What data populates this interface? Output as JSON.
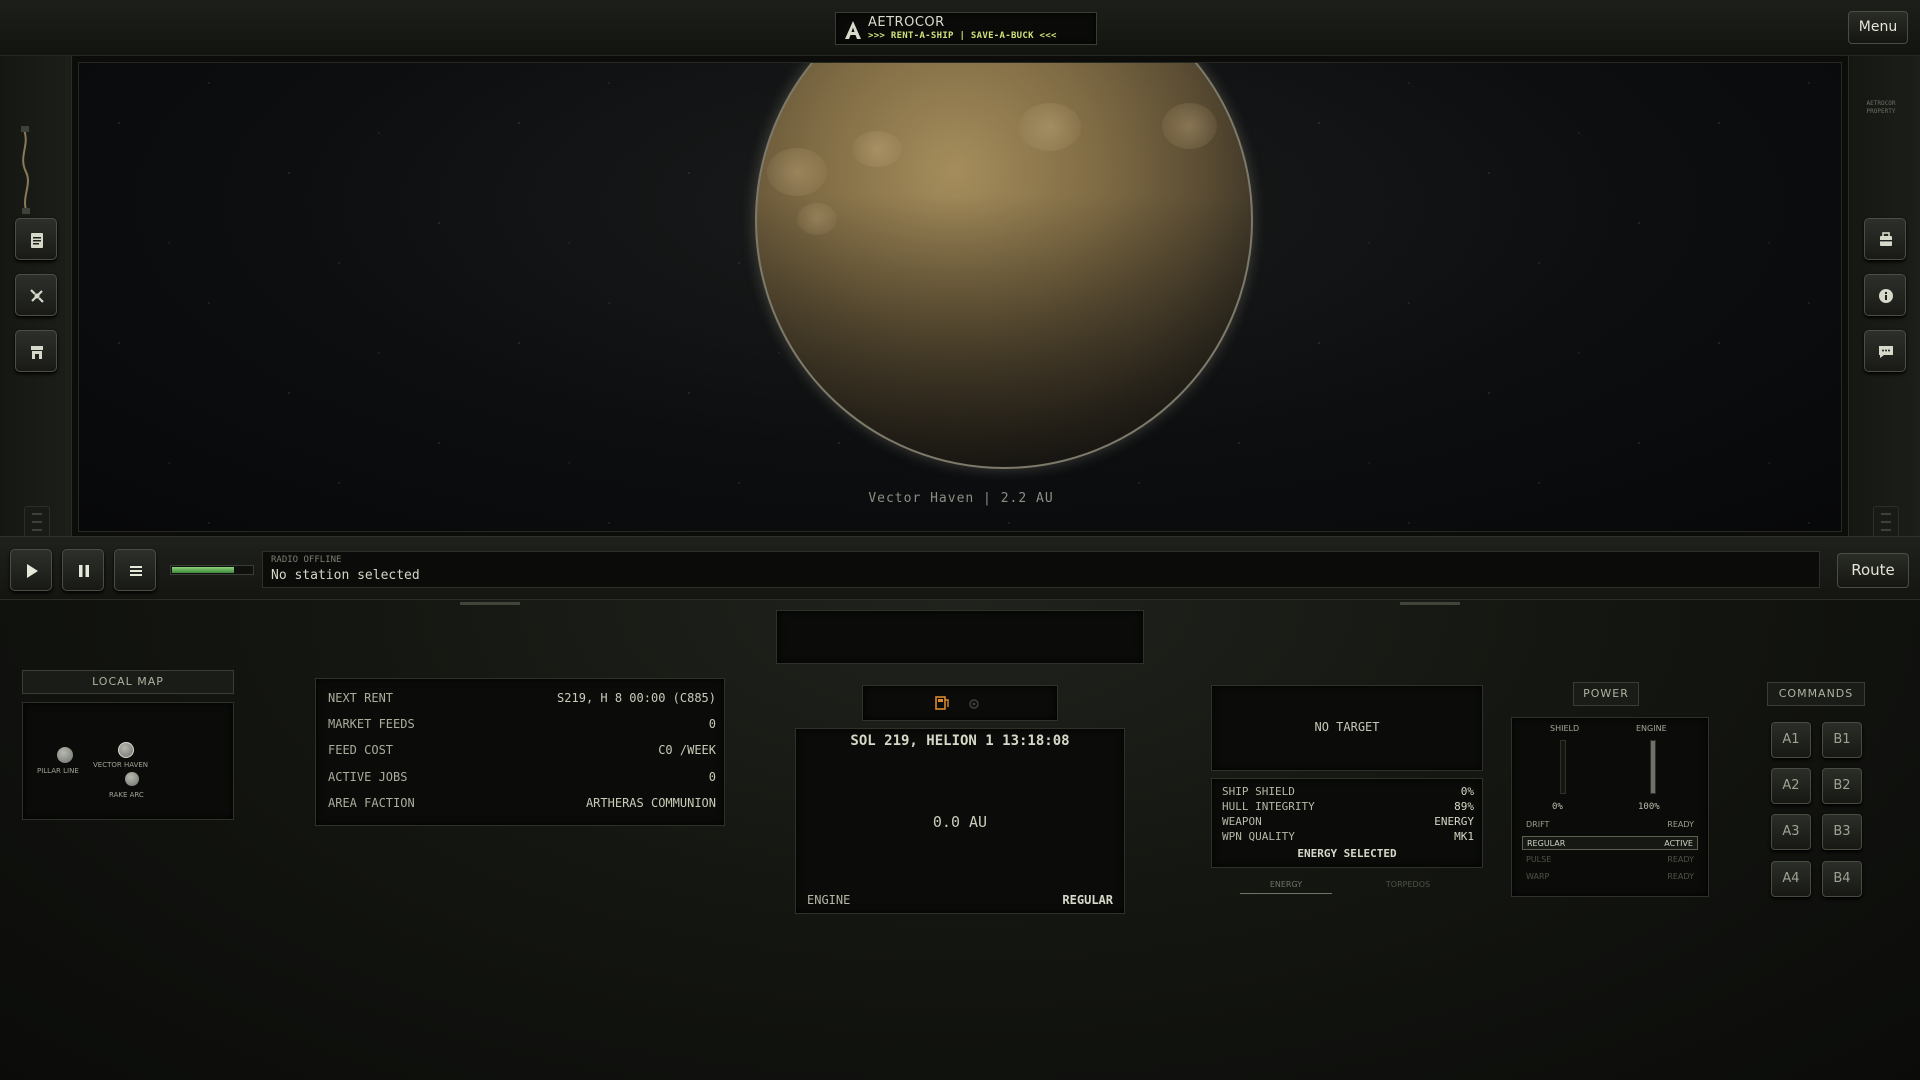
{
  "app": {
    "brand_name": "AETROCOR",
    "brand_tagline": ">>> RENT-A-SHIP | SAVE-A-BUCK <<<",
    "menu_label": "Menu",
    "property_tag": "AETROCOR PROPERTY"
  },
  "viewport": {
    "caption": "Vector Haven | 2.2 AU"
  },
  "left_rail": [
    "clipboard-icon",
    "satellite-icon",
    "store-icon"
  ],
  "right_rail": [
    "cargo-icon",
    "info-icon",
    "chat-icon"
  ],
  "transport": {
    "buttons": [
      "play-icon",
      "pause-icon",
      "list-icon"
    ],
    "volume_fraction": 0.78,
    "radio_status": "RADIO OFFLINE",
    "radio_message": "No station selected",
    "route_label": "Route"
  },
  "local_map": {
    "title": "LOCAL MAP",
    "bodies": [
      {
        "label": "PILLAR LINE"
      },
      {
        "label": "VECTOR HAVEN"
      },
      {
        "label": "RAKE ARC"
      }
    ]
  },
  "station_info": {
    "rows": [
      {
        "label": "NEXT RENT",
        "value": "S219, H 8 00:00 (C885)"
      },
      {
        "label": "MARKET FEEDS",
        "value": "0"
      },
      {
        "label": "FEED COST",
        "value": "C0 /WEEK"
      },
      {
        "label": "ACTIVE JOBS",
        "value": "0"
      },
      {
        "label": "AREA FACTION",
        "value": "ARTHERAS COMMUNION"
      }
    ]
  },
  "nav": {
    "datetime": "SOL 219, HELION 1 13:18:08",
    "distance": "0.0 AU",
    "engine_label": "ENGINE",
    "engine_mode": "REGULAR"
  },
  "combat": {
    "target": "NO TARGET",
    "rows": [
      {
        "label": "SHIP SHIELD",
        "value": "0%"
      },
      {
        "label": "HULL INTEGRITY",
        "value": "89%"
      },
      {
        "label": "WEAPON",
        "value": "ENERGY"
      },
      {
        "label": "WPN QUALITY",
        "value": "MK1"
      }
    ],
    "selected": "ENERGY SELECTED",
    "tabs": [
      "ENERGY",
      "TORPEDOS"
    ]
  },
  "power": {
    "title": "POWER",
    "shield_label": "SHIELD",
    "engine_label": "ENGINE",
    "shield_value": "0%",
    "engine_value": "100%",
    "shield_level": 0.0,
    "engine_level": 1.0,
    "modes": [
      {
        "name": "DRIFT",
        "status": "READY"
      },
      {
        "name": "REGULAR",
        "status": "ACTIVE"
      },
      {
        "name": "PULSE",
        "status": "READY"
      },
      {
        "name": "WARP",
        "status": "READY"
      }
    ]
  },
  "commands": {
    "title": "COMMANDS",
    "buttons": [
      "A1",
      "B1",
      "A2",
      "B2",
      "A3",
      "B3",
      "A4",
      "B4"
    ]
  },
  "colors": {
    "accent": "#cfe27a",
    "volume": "#7cc46b",
    "planet": "#8a7449"
  }
}
